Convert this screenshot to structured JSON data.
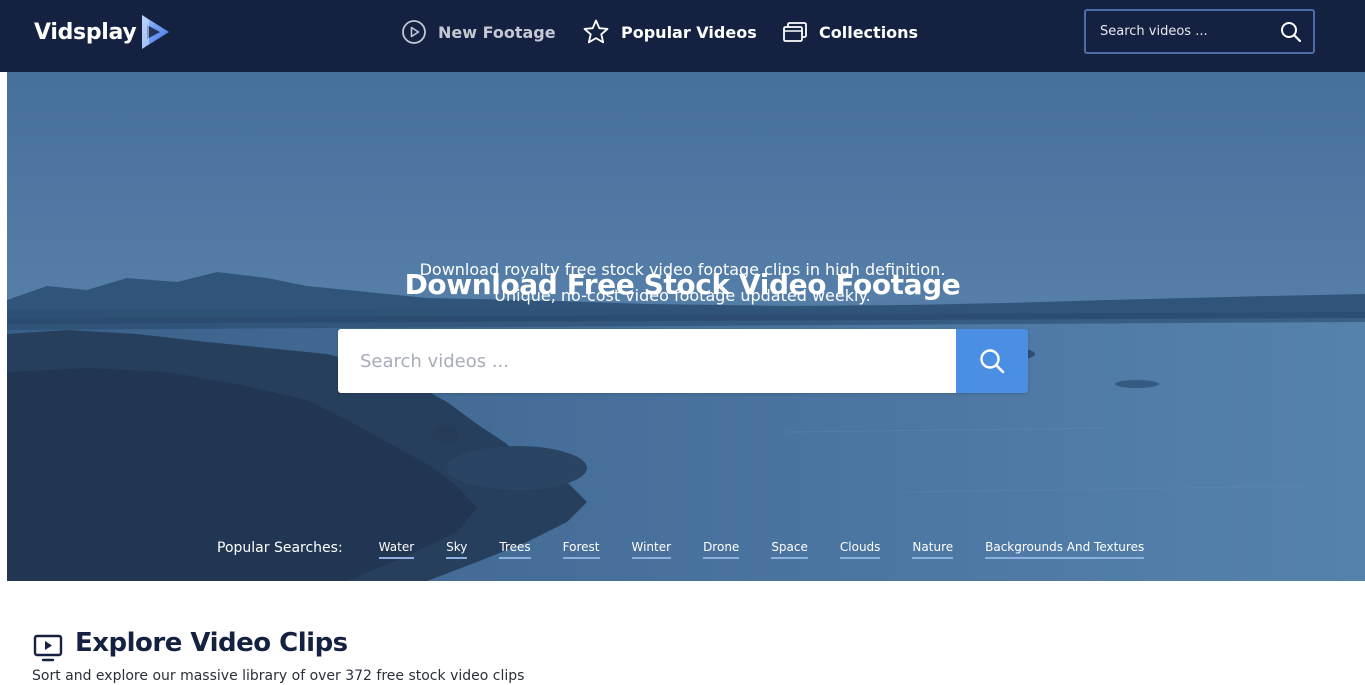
{
  "header": {
    "logo_text": "Vidsplay",
    "nav": {
      "new_footage": "New Footage",
      "popular_videos": "Popular Videos",
      "collections": "Collections"
    },
    "search": {
      "placeholder": "Search videos ..."
    }
  },
  "hero": {
    "title": "Download Free Stock Video Footage",
    "subtitle_line1": "Download royalty free stock video footage clips in high definition.",
    "subtitle_line2": "Unique, no-cost video footage updated weekly.",
    "search": {
      "placeholder": "Search videos ..."
    },
    "popular_label": "Popular Searches:",
    "popular_searches": [
      "Water",
      "Sky",
      "Trees",
      "Forest",
      "Winter",
      "Drone",
      "Space",
      "Clouds",
      "Nature",
      "Backgrounds And Textures"
    ]
  },
  "explore": {
    "title": "Explore Video Clips",
    "subtitle": "Sort and explore our massive library of over 372 free stock video clips"
  },
  "icons": {
    "logo": "play-triangle-logo-icon",
    "new_footage": "play-circle-icon",
    "popular_videos": "star-icon",
    "collections": "stacked-windows-icon",
    "search": "search-icon",
    "explore": "tv-play-icon"
  },
  "colors": {
    "header_bg": "#152141",
    "hero_overlay": "#3d6491",
    "accent_button": "#4a8fe3",
    "tag_underline": "#8cb0df",
    "heading_dark": "#152141"
  }
}
